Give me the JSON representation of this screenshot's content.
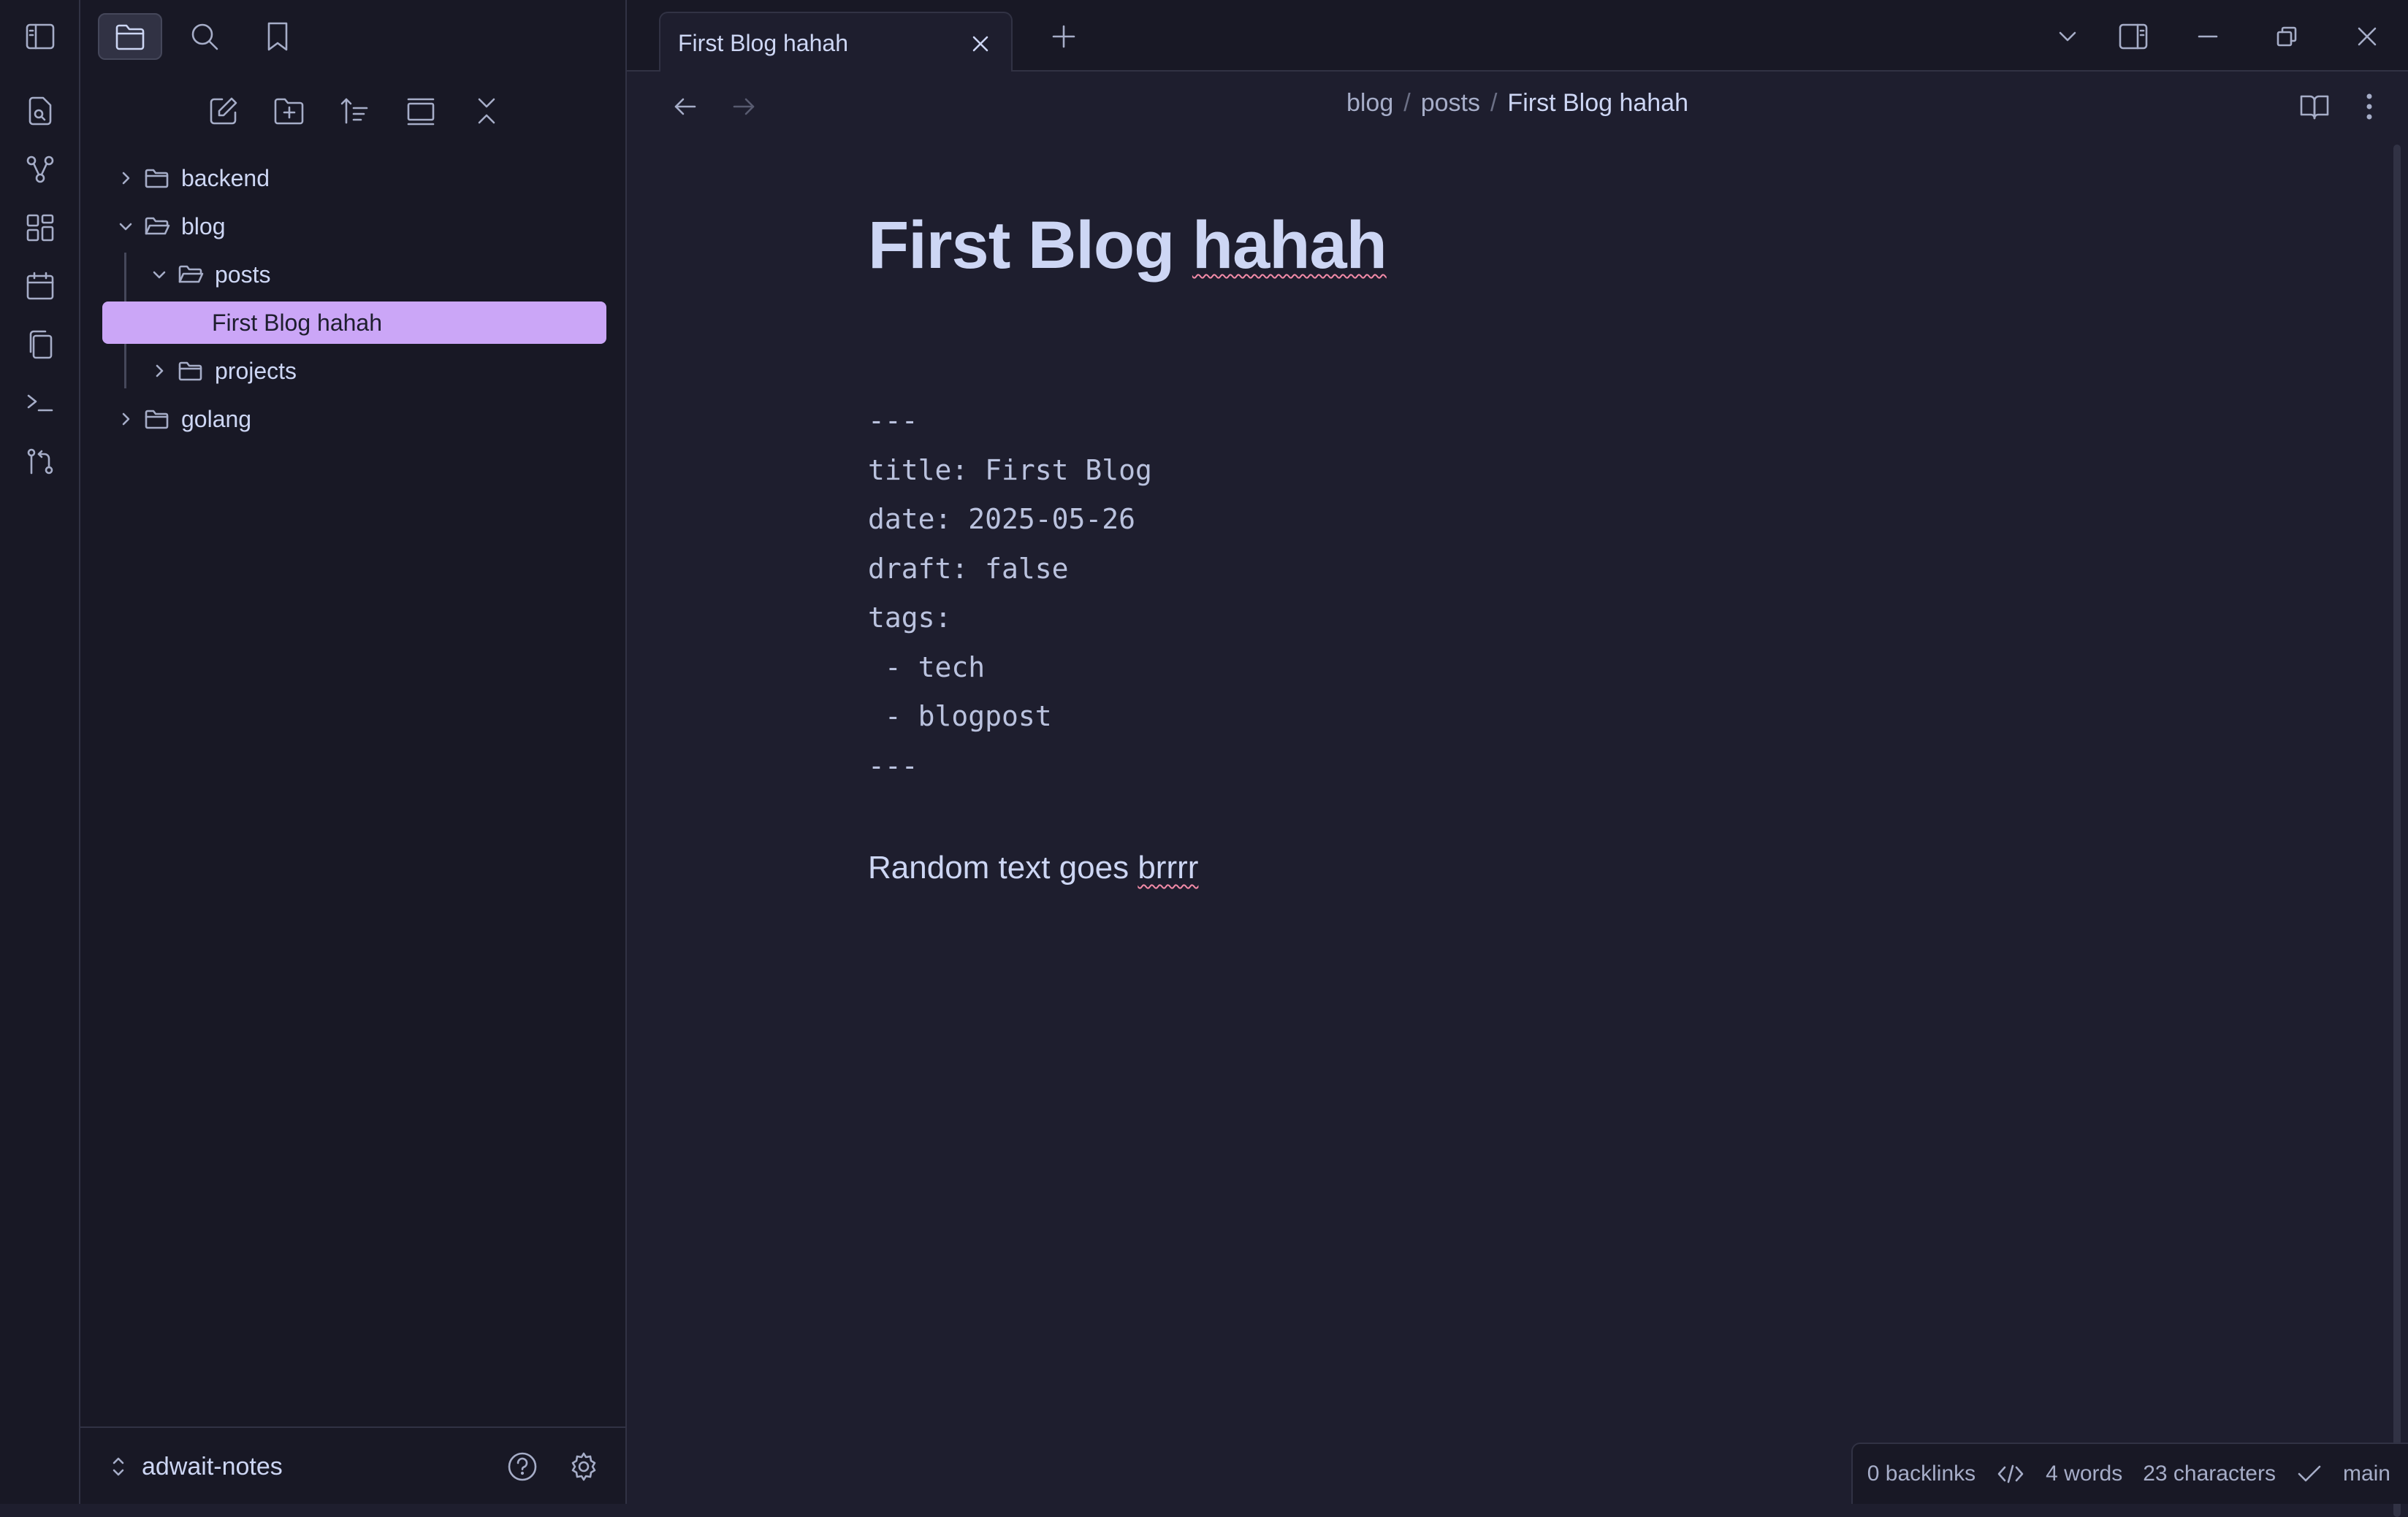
{
  "tab": {
    "title": "First Blog hahah"
  },
  "sidebar": {
    "tree": {
      "backend": "backend",
      "blog": "blog",
      "posts": "posts",
      "file": "First Blog hahah",
      "projects": "projects",
      "golang": "golang"
    },
    "vault_name": "adwait-notes"
  },
  "breadcrumb": {
    "part1": "blog",
    "part2": "posts",
    "current": "First Blog hahah",
    "separator": "/"
  },
  "note": {
    "title_a": "First Blog ",
    "title_b": "hahah",
    "frontmatter": [
      "---",
      "title: First Blog",
      "date: 2025-05-26",
      "draft: false",
      "tags:",
      " - tech",
      " - blogpost",
      "---"
    ],
    "body_a": "Random text goes ",
    "body_b": "brrrr"
  },
  "status": {
    "backlinks": "0 backlinks",
    "words": "4 words",
    "characters": "23 characters",
    "branch": "main"
  },
  "colors": {
    "accent": "#cba6f7",
    "background": "#1e1e2e",
    "sidebar": "#181825",
    "text": "#cdd6f4"
  },
  "icons": [
    "sidebar-toggle-icon",
    "folder-icon",
    "search-icon",
    "bookmark-icon",
    "new-note-icon",
    "new-folder-icon",
    "sort-icon",
    "auto-reveal-icon",
    "collapse-all-icon",
    "chevron-right-icon",
    "chevron-down-icon",
    "close-icon",
    "plus-icon",
    "arrow-left-icon",
    "arrow-right-icon",
    "reading-view-icon",
    "more-options-icon",
    "help-icon",
    "settings-icon",
    "minimize-icon",
    "restore-icon",
    "graph-icon",
    "canvas-icon",
    "calendar-icon",
    "copy-icon",
    "terminal-icon",
    "git-icon",
    "code-icon",
    "check-icon"
  ]
}
